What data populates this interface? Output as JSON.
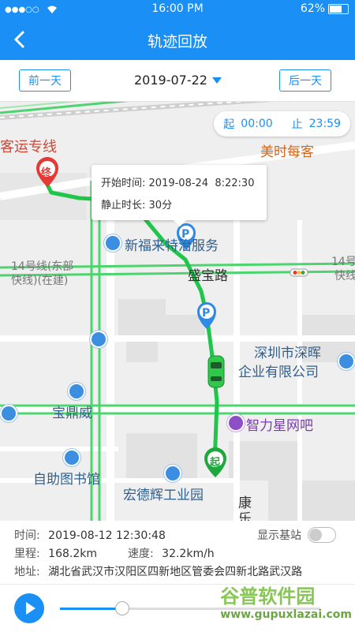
{
  "status": {
    "carrier": "●●●○○",
    "time": "16:00 PM",
    "battery": "62%"
  },
  "header": {
    "title": "轨迹回放"
  },
  "datebar": {
    "prev_label": "前一天",
    "date": "2019-07-22",
    "next_label": "后一天"
  },
  "timerange": {
    "start_label": "起",
    "start": "00:00",
    "end_label": "止",
    "end": "23:59"
  },
  "popup": {
    "start_label": "开始时间:",
    "start_value": "2019-08-24  8:22:30",
    "duration_label": "静止时长:",
    "duration_value": "30分"
  },
  "map_labels": {
    "l1": "客运专线",
    "l2": "美时每客",
    "l3": "新福来特治服务",
    "l4": "盛宝路",
    "l5": "14号线(东部",
    "l6": "快线)(在建)",
    "l7": "14号",
    "l8": "快线",
    "l9": "深圳市深晖",
    "l10": "企业有限公司",
    "l11": "宝鼎威",
    "l12": "智力星网吧",
    "l13": "自助图书馆",
    "l14": "宏德辉工业园",
    "l15": "康",
    "l16": "乐",
    "end_marker": "终",
    "start_marker": "起",
    "p": "P"
  },
  "info": {
    "time_label": "时间:",
    "time_value": "2019-08-12 12:30:48",
    "mileage_label": "里程:",
    "mileage_value": "168.2km",
    "speed_label": "速度:",
    "speed_value": "32.2km/h",
    "address_label": "地址:",
    "address_value": "湖北省武汉市汉阳区四新地区管委会四新北路武汉路",
    "station_toggle_label": "显示基站",
    "station_toggle_on": false
  },
  "playback": {
    "progress": 0.24
  },
  "watermark": {
    "line1": "谷普软件园",
    "line2": "www.gupuxlazai.com"
  },
  "colors": {
    "accent": "#1a8ff5",
    "track": "#1fc64a",
    "end_marker": "#e53935",
    "car": "#2fc84a"
  }
}
